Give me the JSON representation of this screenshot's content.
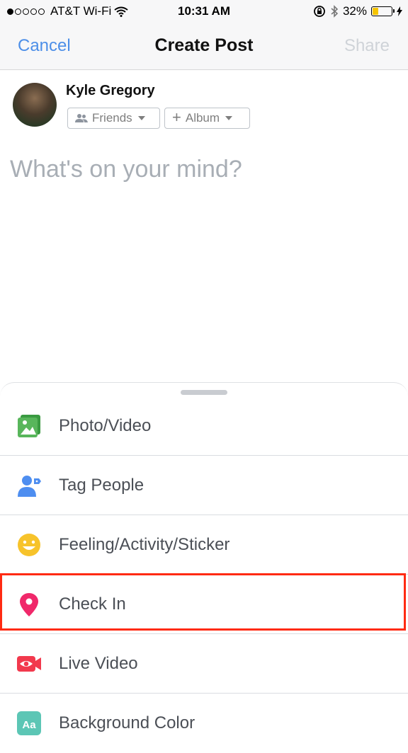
{
  "status_bar": {
    "carrier": "AT&T Wi-Fi",
    "time": "10:31 AM",
    "battery_percent": "32%",
    "battery_level": 0.32
  },
  "nav": {
    "cancel_label": "Cancel",
    "title": "Create Post",
    "share_label": "Share"
  },
  "composer": {
    "user_name": "Kyle Gregory",
    "audience_label": "Friends",
    "album_label": "Album",
    "placeholder": "What's on your mind?"
  },
  "actions": [
    {
      "label": "Photo/Video",
      "icon": "photo-icon",
      "color": "#58b65b"
    },
    {
      "label": "Tag People",
      "icon": "tag-people-icon",
      "color": "#4e8ef0"
    },
    {
      "label": "Feeling/Activity/Sticker",
      "icon": "smiley-icon",
      "color": "#f7c32b"
    },
    {
      "label": "Check In",
      "icon": "location-pin-icon",
      "color": "#f0286a"
    },
    {
      "label": "Live Video",
      "icon": "live-video-icon",
      "color": "#f2394d"
    },
    {
      "label": "Background Color",
      "icon": "background-color-icon",
      "color": "#5cc6b5"
    }
  ],
  "highlight_color": "#ff2a12"
}
